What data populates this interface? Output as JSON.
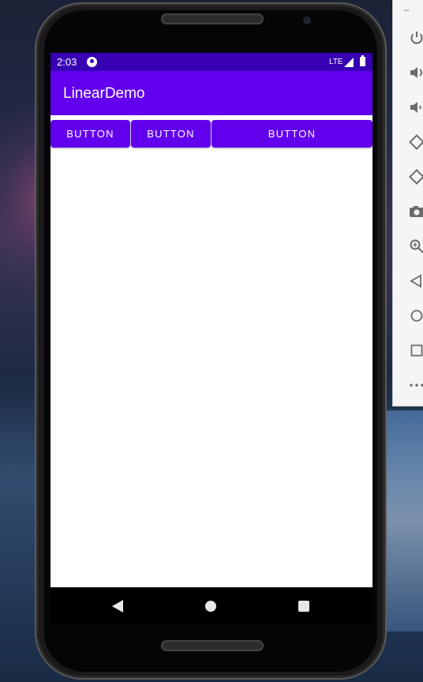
{
  "status_bar": {
    "time": "2:03",
    "network": "LTE",
    "notification_icon": "app-notification-icon",
    "signal_icon": "signal-icon",
    "battery_icon": "battery-icon"
  },
  "app_bar": {
    "title": "LinearDemo",
    "color": "#6200ee"
  },
  "status_bar_color": "#3700b3",
  "buttons": [
    {
      "label": "BUTTON"
    },
    {
      "label": "BUTTON"
    },
    {
      "label": "BUTTON"
    }
  ],
  "nav_bar": {
    "back_icon": "back-triangle-icon",
    "home_icon": "home-circle-icon",
    "recents_icon": "recents-square-icon"
  },
  "emulator_toolbar": {
    "minimize_label": "–",
    "icons": [
      "power-icon",
      "volume-up-icon",
      "volume-down-icon",
      "rotate-left-icon",
      "rotate-right-icon",
      "camera-icon",
      "zoom-icon",
      "back-icon",
      "home-icon",
      "overview-icon",
      "more-icon"
    ]
  }
}
